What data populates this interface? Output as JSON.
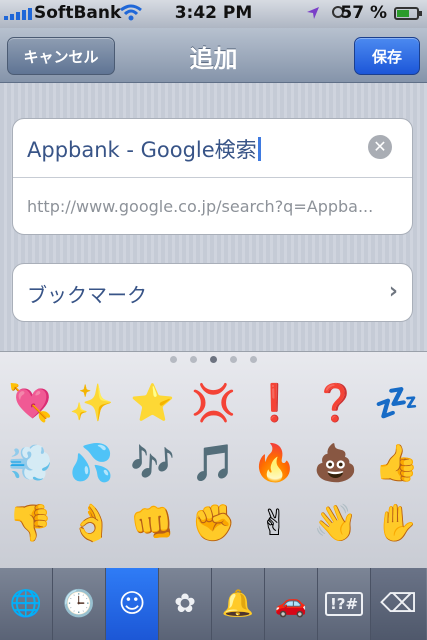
{
  "status": {
    "carrier": "SoftBank",
    "time": "3:42 PM",
    "battery_pct": "57 %"
  },
  "nav": {
    "cancel": "キャンセル",
    "title": "追加",
    "save": "保存"
  },
  "form": {
    "title_value": "Appbank - Google検索",
    "url_value": "http://www.google.co.jp/search?q=Appba...",
    "location_label": "ブックマーク"
  },
  "keyboard": {
    "emoji_rows": [
      [
        "💘",
        "✨",
        "⭐",
        "💢",
        "❗",
        "❓",
        "💤"
      ],
      [
        "💨",
        "💦",
        "🎶",
        "🎵",
        "🔥",
        "💩",
        "👍"
      ],
      [
        "👎",
        "👌",
        "👊",
        "✊",
        "✌",
        "👋",
        "✋"
      ]
    ],
    "categories": [
      {
        "name": "globe-icon",
        "glyph": "🌐"
      },
      {
        "name": "recent-clock-icon",
        "glyph": "🕒"
      },
      {
        "name": "smiley-icon",
        "glyph": "☺"
      },
      {
        "name": "flower-icon",
        "glyph": "✿"
      },
      {
        "name": "bell-icon",
        "glyph": "🔔"
      },
      {
        "name": "car-icon",
        "glyph": "🚗"
      },
      {
        "name": "symbols-icon",
        "glyph": "!?#"
      },
      {
        "name": "delete-icon",
        "glyph": "⌫"
      }
    ]
  },
  "colors": {
    "accent": "#1c56d8",
    "nav": "#8594aa"
  }
}
